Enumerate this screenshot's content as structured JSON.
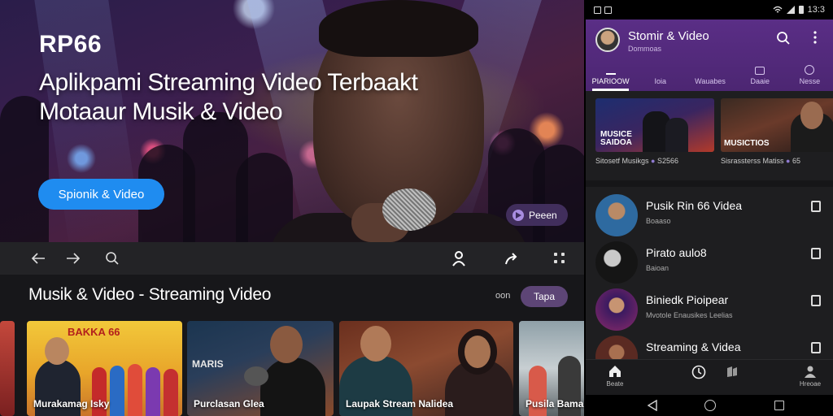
{
  "hero": {
    "brand": "RP66",
    "title_line1": "Aplikpami Streaming Video Terbaakt",
    "title_line2": "Motaaur Musik & Video",
    "cta_label": "Spionik & Video",
    "chip_label": "Peeen"
  },
  "toolbar": {
    "icons": [
      "back-arrow-icon",
      "forward-arrow-icon",
      "search-icon",
      "user-icon",
      "share-icon",
      "grid-icon"
    ]
  },
  "section": {
    "title": "Musik & Video - Streaming Video",
    "more_label": "oon",
    "chip_label": "Tapa"
  },
  "cards": [
    {
      "poster_text": "BAKKA 66",
      "caption": "Murakamag Isky"
    },
    {
      "poster_text": "MARIS",
      "caption": "Purclasan Glea"
    },
    {
      "poster_text": "",
      "caption": "Laupak Stream Nalidea"
    },
    {
      "poster_text": "",
      "caption": "Pusila Bamai"
    }
  ],
  "phone": {
    "status": {
      "time": "13:3"
    },
    "app_title": "Stomir & Video",
    "app_subtitle": "Dommoas",
    "tabs": [
      {
        "label": "PIARIOOW",
        "active": true
      },
      {
        "label": "Ioia",
        "active": false
      },
      {
        "label": "Wauabes",
        "active": false
      },
      {
        "label": "Daaie",
        "active": false
      },
      {
        "label": "Nesse",
        "active": false
      }
    ],
    "thumbs": [
      {
        "poster_text": "MUSICE SAIDOA",
        "caption": "Sitosetf Musikgs",
        "meta": "S2566"
      },
      {
        "poster_text": "MUSICTIOS",
        "caption": "Sisrassterss Matiss",
        "meta": "65"
      }
    ],
    "list": [
      {
        "title": "Pusik Rin 66 Videa",
        "subtitle": "Boaaso"
      },
      {
        "title": "Pirato aulo8",
        "subtitle": "Baioan"
      },
      {
        "title": "Biniedk Pioipear",
        "subtitle": "Mvotole Enausikes Leelias"
      },
      {
        "title": "Streaming & Videa",
        "subtitle": ""
      }
    ],
    "bottom_nav": [
      {
        "label": "Beate",
        "icon": "home-icon"
      },
      {
        "label": "",
        "icon": "clock-icon"
      },
      {
        "label": "",
        "icon": "library-icon"
      },
      {
        "label": "Hreoae",
        "icon": "profile-icon"
      }
    ]
  },
  "colors": {
    "accent_blue": "#1f8cf0",
    "accent_purple": "#5a2e86",
    "chip_purple": "#5d4576"
  }
}
